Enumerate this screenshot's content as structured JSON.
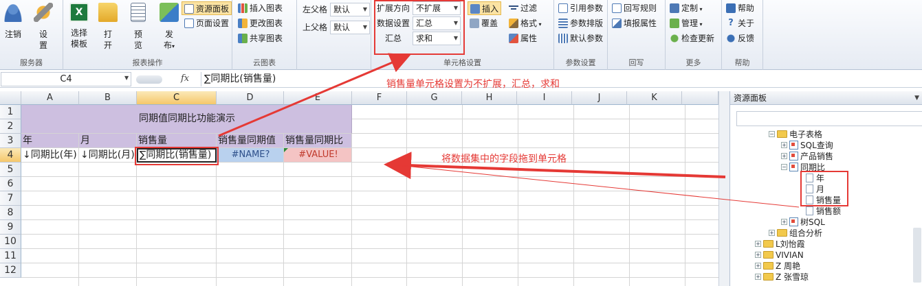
{
  "ribbon": {
    "groups": {
      "server": "服务器",
      "report_ops": "报表操作",
      "cloud_chart": "云图表",
      "cell_settings": "单元格设置",
      "params": "参数设置",
      "writeback": "回写",
      "more": "更多",
      "help": "帮助"
    },
    "buttons": {
      "logout": "注销",
      "settings": "设",
      "settings2": "置",
      "select_template": "选择",
      "select_template2": "模板",
      "open": "打",
      "open2": "开",
      "preview": "预",
      "preview2": "览",
      "publish": "发",
      "publish2": "布",
      "resource_panel": "资源面板",
      "page_setup": "页面设置",
      "insert_chart": "插入图表",
      "change_chart": "更改图表",
      "share_chart": "共享图表",
      "left_parent": "左父格",
      "top_parent": "上父格",
      "default": "默认",
      "expand_dir": "扩展方向",
      "expand_val": "不扩展",
      "data_setting": "数据设置",
      "data_val": "汇总",
      "summary": "汇总",
      "summary_val": "求和",
      "insert": "插入",
      "cover": "覆盖",
      "filter": "过滤",
      "format": "格式",
      "property": "属性",
      "ref_param": "引用参数",
      "param_layout": "参数排版",
      "default_param": "默认参数",
      "writeback_rule": "回写规则",
      "fill_prop": "填报属性",
      "custom": "定制",
      "manage": "管理",
      "check_update": "检查更新",
      "help": "帮助",
      "about": "关于",
      "feedback": "反馈"
    }
  },
  "formula_bar": {
    "name_box": "C4",
    "fx": "fx",
    "formula": "∑同期比(销售量)"
  },
  "sheet": {
    "columns": [
      "A",
      "B",
      "C",
      "D",
      "E",
      "F",
      "G",
      "H",
      "I",
      "J",
      "K"
    ],
    "rows": [
      "1",
      "2",
      "3",
      "4",
      "5",
      "6",
      "7",
      "8",
      "9",
      "10",
      "11",
      "12"
    ],
    "title": "同期值同期比功能演示",
    "headers": [
      "年",
      "月",
      "销售量",
      "销售量同期值",
      "销售量同期比"
    ],
    "row4": [
      "↓同期比(年)",
      "↓同期比(月)",
      "∑同期比(销售量)",
      "#NAME?",
      "#VALUE!"
    ]
  },
  "annotations": {
    "top": "销售量单元格设置为不扩展，汇总，求和",
    "middle": "将数据集中的字段拖到单元格"
  },
  "panel": {
    "title": "资源面板",
    "tree": {
      "spreadsheet": "电子表格",
      "sql_query": "SQL查询",
      "product_sales": "产品销售",
      "yoy": "同期比",
      "year": "年",
      "month": "月",
      "sales_qty": "销售量",
      "sales_amt": "销售额",
      "tree_sql": "树SQL",
      "combo": "组合分析",
      "liu": "L刘怡霞",
      "vivian": "VIVIAN",
      "zhou": "Z 周艳",
      "zhang": "Z 张雪琼"
    }
  },
  "colors": {
    "title_bg": "#cdbfe0",
    "header_bg": "#cdbfe0",
    "name_err_bg": "#b9d1ee",
    "value_err_bg": "#f4c4c4",
    "annotation": "#e53935",
    "highlight_box": "#e53935"
  }
}
